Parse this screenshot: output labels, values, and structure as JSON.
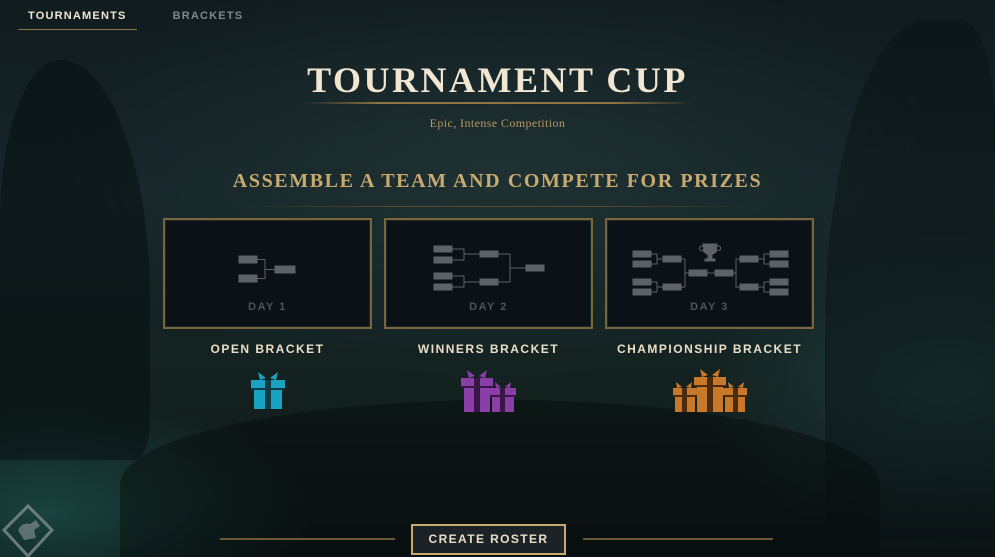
{
  "nav": {
    "tabs": [
      {
        "label": "TOURNAMENTS",
        "active": true
      },
      {
        "label": "BRACKETS",
        "active": false
      }
    ]
  },
  "header": {
    "title": "TOURNAMENT CUP",
    "subtitle": "Epic, Intense Competition"
  },
  "tagline": "ASSEMBLE A TEAM AND COMPETE FOR PRIZES",
  "cards": [
    {
      "day": "DAY 1",
      "name": "OPEN BRACKET",
      "icon": "bracket-small-icon",
      "prize_icon": "gift-icon",
      "prize_color": "#1aa3c0"
    },
    {
      "day": "DAY 2",
      "name": "WINNERS BRACKET",
      "icon": "bracket-medium-icon",
      "prize_icon": "gifts-icon",
      "prize_color": "#8a3fa8"
    },
    {
      "day": "DAY 3",
      "name": "CHAMPIONSHIP BRACKET",
      "icon": "bracket-trophy-icon",
      "prize_icon": "gift-pile-icon",
      "prize_color": "#c8782a"
    }
  ],
  "actions": {
    "create_roster": "CREATE ROSTER"
  },
  "colors": {
    "gold": "#c8aa6e",
    "light_text": "#f0e6d2",
    "card_border": "#7a6439",
    "background": "#13211f"
  }
}
